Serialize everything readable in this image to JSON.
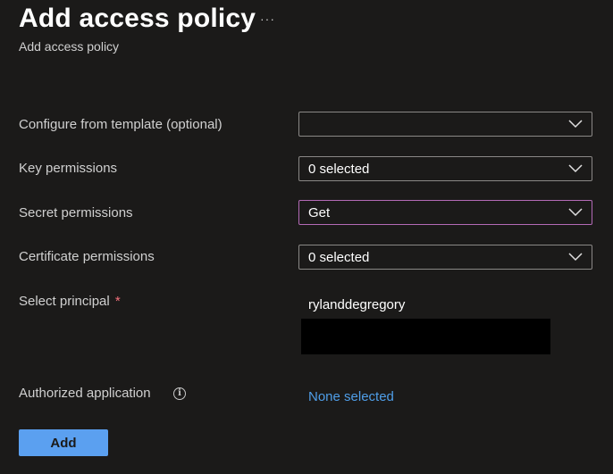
{
  "header": {
    "title": "Add access policy",
    "more_icon": "more-icon",
    "subtitle": "Add access policy"
  },
  "form": {
    "template": {
      "label": "Configure from template (optional)",
      "value": ""
    },
    "key_permissions": {
      "label": "Key permissions",
      "value": "0 selected"
    },
    "secret_permissions": {
      "label": "Secret permissions",
      "value": "Get"
    },
    "certificate_permissions": {
      "label": "Certificate permissions",
      "value": "0 selected"
    },
    "principal": {
      "label": "Select principal",
      "required_mark": "*",
      "value": "rylanddegregory"
    },
    "authorized_application": {
      "label": "Authorized application",
      "info_icon": "info-icon",
      "link": "None selected"
    }
  },
  "actions": {
    "add_label": "Add"
  },
  "colors": {
    "background": "#1b1a19",
    "accent_button": "#5ba0f0",
    "link": "#4f9ee8",
    "focus_border": "#b36ab6",
    "required": "#f1707b"
  }
}
